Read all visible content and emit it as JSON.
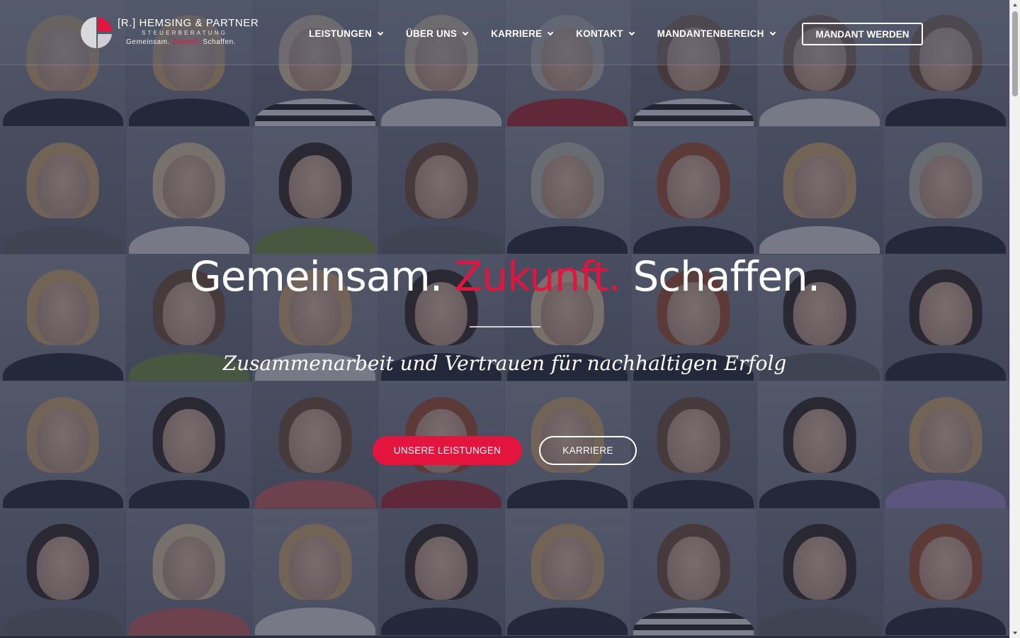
{
  "brand": {
    "title": "[R.] HEMSING & PARTNER",
    "subtitle": "STEUERBERATUNG",
    "tagline_part1": "Gemeinsam.",
    "tagline_part2": "Zukunft.",
    "tagline_part3": "Schaffen.",
    "accent_color": "#e3153f"
  },
  "nav": {
    "items": [
      {
        "label": "LEISTUNGEN"
      },
      {
        "label": "ÜBER UNS"
      },
      {
        "label": "KARRIERE"
      },
      {
        "label": "KONTAKT"
      },
      {
        "label": "MANDANTENBEREICH"
      }
    ],
    "cta_label": "MANDANT WERDEN"
  },
  "hero": {
    "title_part1": "Gemeinsam.",
    "title_part2": "Zukunft.",
    "title_part3": "Schaffen.",
    "subtitle": "Zusammenarbeit und Vertrauen für nachhaltigen Erfolg",
    "primary_button": "UNSERE LEISTUNGEN",
    "secondary_button": "KARRIERE"
  },
  "icons": [
    "logo-mark-icon",
    "chevron-down-icon"
  ]
}
